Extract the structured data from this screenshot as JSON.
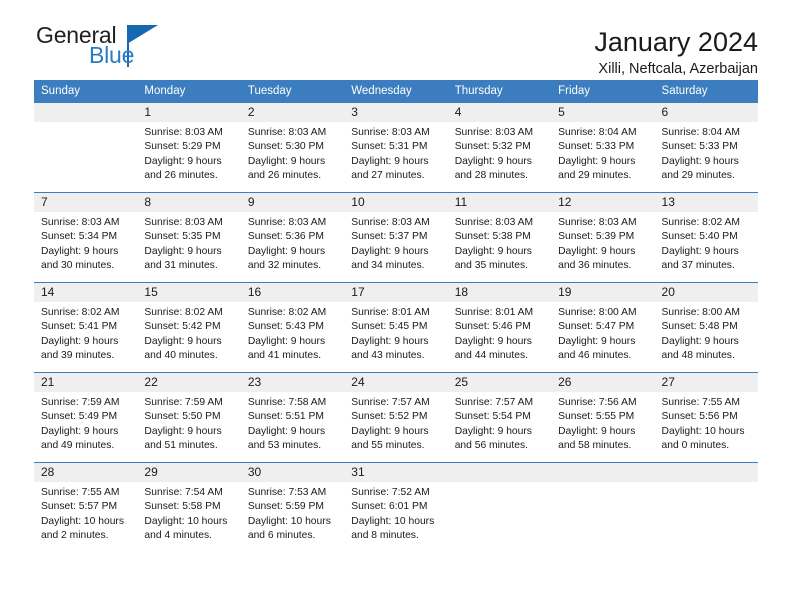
{
  "logo": {
    "word1": "General",
    "word2": "Blue",
    "triangle_color": "#1668b0",
    "text_color": "#231f20",
    "blue_color": "#2a7bc4"
  },
  "header": {
    "title": "January 2024",
    "subtitle": "Xilli, Neftcala, Azerbaijan"
  },
  "theme": {
    "header_bg": "#3b7dbf",
    "header_text": "#ffffff",
    "daynum_bg": "#efefef",
    "page_bg": "#ffffff"
  },
  "calendar": {
    "weekday_headers": [
      "Sunday",
      "Monday",
      "Tuesday",
      "Wednesday",
      "Thursday",
      "Friday",
      "Saturday"
    ],
    "weeks": [
      [
        {
          "day": "",
          "lines": []
        },
        {
          "day": "1",
          "lines": [
            "Sunrise: 8:03 AM",
            "Sunset: 5:29 PM",
            "Daylight: 9 hours",
            "and 26 minutes."
          ]
        },
        {
          "day": "2",
          "lines": [
            "Sunrise: 8:03 AM",
            "Sunset: 5:30 PM",
            "Daylight: 9 hours",
            "and 26 minutes."
          ]
        },
        {
          "day": "3",
          "lines": [
            "Sunrise: 8:03 AM",
            "Sunset: 5:31 PM",
            "Daylight: 9 hours",
            "and 27 minutes."
          ]
        },
        {
          "day": "4",
          "lines": [
            "Sunrise: 8:03 AM",
            "Sunset: 5:32 PM",
            "Daylight: 9 hours",
            "and 28 minutes."
          ]
        },
        {
          "day": "5",
          "lines": [
            "Sunrise: 8:04 AM",
            "Sunset: 5:33 PM",
            "Daylight: 9 hours",
            "and 29 minutes."
          ]
        },
        {
          "day": "6",
          "lines": [
            "Sunrise: 8:04 AM",
            "Sunset: 5:33 PM",
            "Daylight: 9 hours",
            "and 29 minutes."
          ]
        }
      ],
      [
        {
          "day": "7",
          "lines": [
            "Sunrise: 8:03 AM",
            "Sunset: 5:34 PM",
            "Daylight: 9 hours",
            "and 30 minutes."
          ]
        },
        {
          "day": "8",
          "lines": [
            "Sunrise: 8:03 AM",
            "Sunset: 5:35 PM",
            "Daylight: 9 hours",
            "and 31 minutes."
          ]
        },
        {
          "day": "9",
          "lines": [
            "Sunrise: 8:03 AM",
            "Sunset: 5:36 PM",
            "Daylight: 9 hours",
            "and 32 minutes."
          ]
        },
        {
          "day": "10",
          "lines": [
            "Sunrise: 8:03 AM",
            "Sunset: 5:37 PM",
            "Daylight: 9 hours",
            "and 34 minutes."
          ]
        },
        {
          "day": "11",
          "lines": [
            "Sunrise: 8:03 AM",
            "Sunset: 5:38 PM",
            "Daylight: 9 hours",
            "and 35 minutes."
          ]
        },
        {
          "day": "12",
          "lines": [
            "Sunrise: 8:03 AM",
            "Sunset: 5:39 PM",
            "Daylight: 9 hours",
            "and 36 minutes."
          ]
        },
        {
          "day": "13",
          "lines": [
            "Sunrise: 8:02 AM",
            "Sunset: 5:40 PM",
            "Daylight: 9 hours",
            "and 37 minutes."
          ]
        }
      ],
      [
        {
          "day": "14",
          "lines": [
            "Sunrise: 8:02 AM",
            "Sunset: 5:41 PM",
            "Daylight: 9 hours",
            "and 39 minutes."
          ]
        },
        {
          "day": "15",
          "lines": [
            "Sunrise: 8:02 AM",
            "Sunset: 5:42 PM",
            "Daylight: 9 hours",
            "and 40 minutes."
          ]
        },
        {
          "day": "16",
          "lines": [
            "Sunrise: 8:02 AM",
            "Sunset: 5:43 PM",
            "Daylight: 9 hours",
            "and 41 minutes."
          ]
        },
        {
          "day": "17",
          "lines": [
            "Sunrise: 8:01 AM",
            "Sunset: 5:45 PM",
            "Daylight: 9 hours",
            "and 43 minutes."
          ]
        },
        {
          "day": "18",
          "lines": [
            "Sunrise: 8:01 AM",
            "Sunset: 5:46 PM",
            "Daylight: 9 hours",
            "and 44 minutes."
          ]
        },
        {
          "day": "19",
          "lines": [
            "Sunrise: 8:00 AM",
            "Sunset: 5:47 PM",
            "Daylight: 9 hours",
            "and 46 minutes."
          ]
        },
        {
          "day": "20",
          "lines": [
            "Sunrise: 8:00 AM",
            "Sunset: 5:48 PM",
            "Daylight: 9 hours",
            "and 48 minutes."
          ]
        }
      ],
      [
        {
          "day": "21",
          "lines": [
            "Sunrise: 7:59 AM",
            "Sunset: 5:49 PM",
            "Daylight: 9 hours",
            "and 49 minutes."
          ]
        },
        {
          "day": "22",
          "lines": [
            "Sunrise: 7:59 AM",
            "Sunset: 5:50 PM",
            "Daylight: 9 hours",
            "and 51 minutes."
          ]
        },
        {
          "day": "23",
          "lines": [
            "Sunrise: 7:58 AM",
            "Sunset: 5:51 PM",
            "Daylight: 9 hours",
            "and 53 minutes."
          ]
        },
        {
          "day": "24",
          "lines": [
            "Sunrise: 7:57 AM",
            "Sunset: 5:52 PM",
            "Daylight: 9 hours",
            "and 55 minutes."
          ]
        },
        {
          "day": "25",
          "lines": [
            "Sunrise: 7:57 AM",
            "Sunset: 5:54 PM",
            "Daylight: 9 hours",
            "and 56 minutes."
          ]
        },
        {
          "day": "26",
          "lines": [
            "Sunrise: 7:56 AM",
            "Sunset: 5:55 PM",
            "Daylight: 9 hours",
            "and 58 minutes."
          ]
        },
        {
          "day": "27",
          "lines": [
            "Sunrise: 7:55 AM",
            "Sunset: 5:56 PM",
            "Daylight: 10 hours",
            "and 0 minutes."
          ]
        }
      ],
      [
        {
          "day": "28",
          "lines": [
            "Sunrise: 7:55 AM",
            "Sunset: 5:57 PM",
            "Daylight: 10 hours",
            "and 2 minutes."
          ]
        },
        {
          "day": "29",
          "lines": [
            "Sunrise: 7:54 AM",
            "Sunset: 5:58 PM",
            "Daylight: 10 hours",
            "and 4 minutes."
          ]
        },
        {
          "day": "30",
          "lines": [
            "Sunrise: 7:53 AM",
            "Sunset: 5:59 PM",
            "Daylight: 10 hours",
            "and 6 minutes."
          ]
        },
        {
          "day": "31",
          "lines": [
            "Sunrise: 7:52 AM",
            "Sunset: 6:01 PM",
            "Daylight: 10 hours",
            "and 8 minutes."
          ]
        },
        {
          "day": "",
          "lines": []
        },
        {
          "day": "",
          "lines": []
        },
        {
          "day": "",
          "lines": []
        }
      ]
    ]
  }
}
